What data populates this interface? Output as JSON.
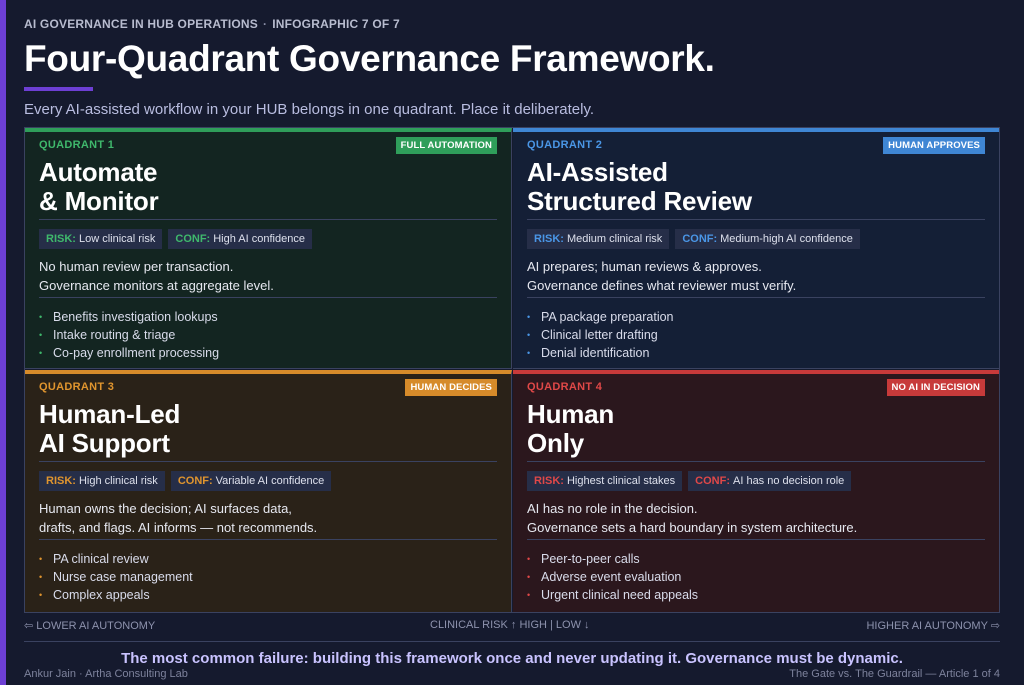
{
  "kicker": {
    "series": "AI GOVERNANCE IN HUB OPERATIONS",
    "separator": "·",
    "number": "INFOGRAPHIC 7 OF 7"
  },
  "title": "Four-Quadrant Governance Framework.",
  "subtitle": "Every AI-assisted workflow in your HUB belongs in one quadrant. Place it deliberately.",
  "colors": {
    "q1": "#2f9e5a",
    "q2": "#3f86d4",
    "q3": "#d68b2a",
    "q4": "#c73a3a",
    "accent": "#6d3fd4"
  },
  "quadrants": [
    {
      "label": "QUADRANT 1",
      "badge": "FULL AUTOMATION",
      "title_line1": "Automate",
      "title_line2": "& Monitor",
      "risk_key": "RISK:",
      "risk_value": "Low clinical risk",
      "conf_key": "CONF:",
      "conf_value": "High AI confidence",
      "desc_line1": "No human review per transaction.",
      "desc_line2": "Governance monitors at aggregate level.",
      "bullet": "•",
      "items": [
        "Benefits investigation lookups",
        "Intake routing & triage",
        "Co-pay enrollment processing"
      ]
    },
    {
      "label": "QUADRANT 2",
      "badge": "HUMAN APPROVES",
      "title_line1": "AI-Assisted",
      "title_line2": "Structured Review",
      "risk_key": "RISK:",
      "risk_value": "Medium clinical risk",
      "conf_key": "CONF:",
      "conf_value": "Medium-high AI confidence",
      "desc_line1": "AI prepares; human reviews & approves.",
      "desc_line2": "Governance defines what reviewer must verify.",
      "bullet": "•",
      "items": [
        "PA package preparation",
        "Clinical letter drafting",
        "Denial identification"
      ]
    },
    {
      "label": "QUADRANT 3",
      "badge": "HUMAN DECIDES",
      "title_line1": "Human-Led",
      "title_line2": "AI Support",
      "risk_key": "RISK:",
      "risk_value": "High clinical risk",
      "conf_key": "CONF:",
      "conf_value": "Variable AI confidence",
      "desc_line1": "Human owns the decision; AI surfaces data,",
      "desc_line2": "drafts, and flags. AI informs — not recommends.",
      "bullet": "•",
      "items": [
        "PA clinical review",
        "Nurse case management",
        "Complex appeals"
      ]
    },
    {
      "label": "QUADRANT 4",
      "badge": "NO AI IN DECISION",
      "title_line1": "Human",
      "title_line2": "Only",
      "risk_key": "RISK:",
      "risk_value": "Highest clinical stakes",
      "conf_key": "CONF:",
      "conf_value": "AI has no decision role",
      "desc_line1": "AI has no role in the decision.",
      "desc_line2": "Governance sets a hard boundary in system architecture.",
      "bullet": "•",
      "items": [
        "Peer-to-peer calls",
        "Adverse event evaluation",
        "Urgent clinical need appeals"
      ]
    }
  ],
  "axis": {
    "left": "⇦ LOWER AI AUTONOMY",
    "center": "CLINICAL RISK ↑ HIGH | LOW ↓",
    "right": "HIGHER AI AUTONOMY ⇨"
  },
  "callout": "The most common failure: building this framework once and never updating it. Governance must be dynamic.",
  "footer": {
    "left": "Ankur Jain · Artha Consulting Lab",
    "right": "The Gate vs. The Guardrail — Article 1 of 4"
  }
}
